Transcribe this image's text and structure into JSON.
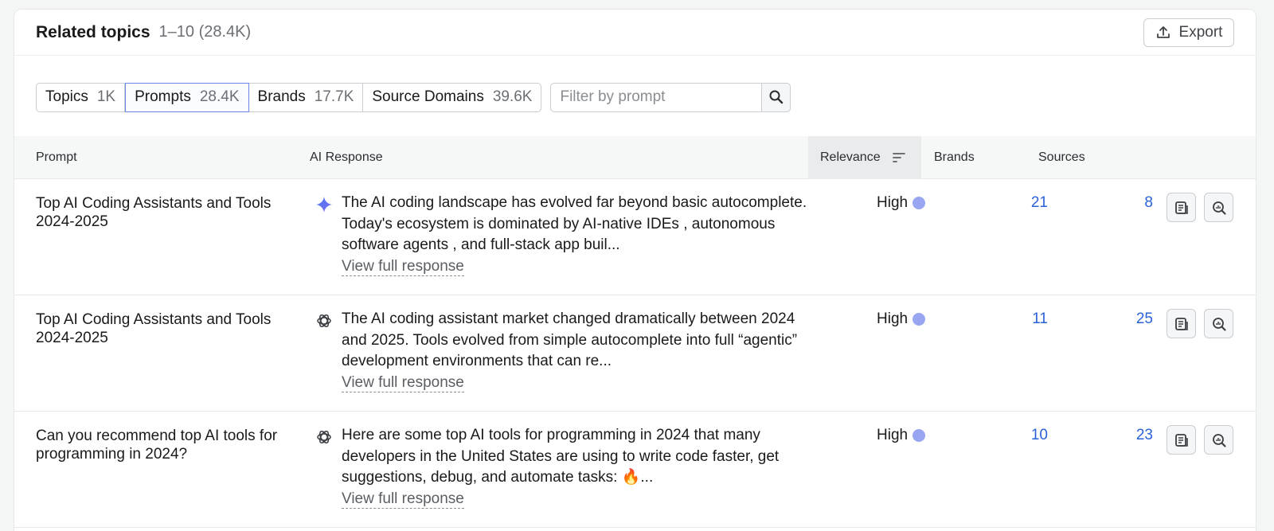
{
  "header": {
    "title": "Related topics",
    "range": "1–10 (28.4K)",
    "export_label": "Export"
  },
  "tabs": [
    {
      "label": "Topics",
      "count": "1K",
      "active": false
    },
    {
      "label": "Prompts",
      "count": "28.4K",
      "active": true
    },
    {
      "label": "Brands",
      "count": "17.7K",
      "active": false
    },
    {
      "label": "Source Domains",
      "count": "39.6K",
      "active": false
    }
  ],
  "filter": {
    "placeholder": "Filter by prompt",
    "value": ""
  },
  "columns": {
    "prompt": "Prompt",
    "ai_response": "AI Response",
    "relevance": "Relevance",
    "brands": "Brands",
    "sources": "Sources"
  },
  "rows": [
    {
      "prompt": "Top AI Coding Assistants and Tools 2024-2025",
      "ai_icon": "gemini-icon",
      "response": "The AI coding landscape has evolved far beyond basic autocomplete. Today's ecosystem is dominated by AI-native IDEs , autonomous software agents , and full-stack app buil...",
      "view_label": "View full response",
      "relevance": "High",
      "brands": "21",
      "sources": "8"
    },
    {
      "prompt": "Top AI Coding Assistants and Tools 2024-2025",
      "ai_icon": "chatgpt-icon",
      "response": "The AI coding assistant market changed dramatically between 2024 and 2025. Tools evolved from simple autocomplete into full “agentic” development environments that can re...",
      "view_label": "View full response",
      "relevance": "High",
      "brands": "11",
      "sources": "25"
    },
    {
      "prompt": "Can you recommend top AI tools for programming in 2024?",
      "ai_icon": "chatgpt-icon",
      "response": "Here are some top AI tools for programming in 2024 that many developers in the United States are using to write code faster, get suggestions, debug, and automate tasks: 🔥...",
      "view_label": "View full response",
      "relevance": "High",
      "brands": "10",
      "sources": "23"
    }
  ],
  "colors": {
    "link": "#2a62d8",
    "relevance_dot": "#98a6f1",
    "active_tab_border": "#6c85ea"
  }
}
